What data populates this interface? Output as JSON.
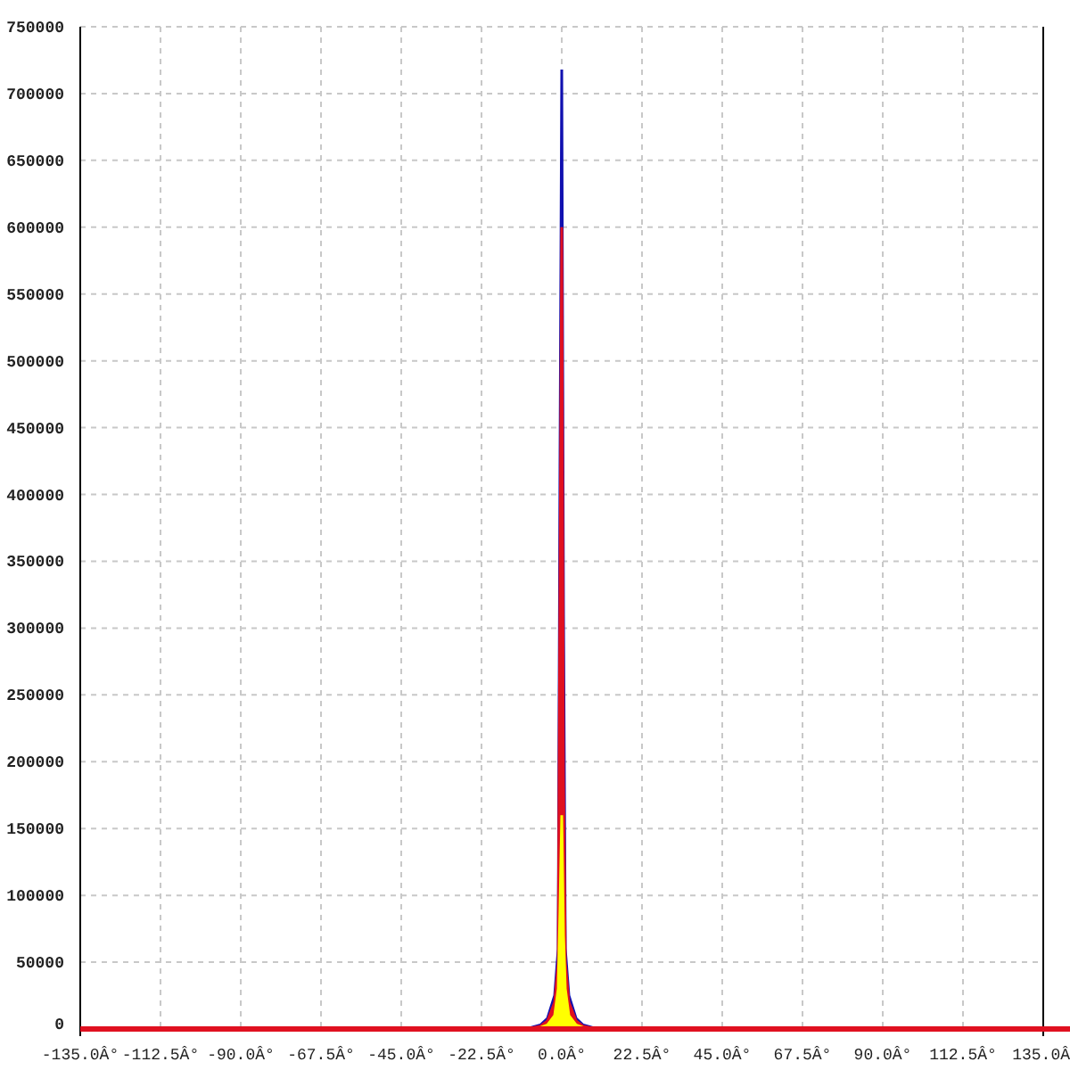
{
  "chart": {
    "chart_data": {
      "type": "area",
      "x": [
        -135,
        -10,
        -6,
        -4,
        -2,
        -1,
        -0.5,
        0,
        0.5,
        1,
        2,
        4,
        6,
        10,
        135
      ],
      "series": [
        {
          "color": "#1010b0",
          "values": [
            0,
            0,
            3000,
            8000,
            25000,
            60000,
            420000,
            718000,
            310000,
            60000,
            25000,
            8000,
            3000,
            0,
            0
          ]
        },
        {
          "color": "#e01020",
          "values": [
            0,
            0,
            2000,
            6000,
            20000,
            50000,
            330000,
            600000,
            190000,
            50000,
            20000,
            6000,
            2000,
            0,
            0
          ]
        },
        {
          "color": "#ffff00",
          "values": [
            0,
            0,
            1000,
            3000,
            10000,
            30000,
            90000,
            160000,
            70000,
            30000,
            10000,
            3000,
            1000,
            0,
            0
          ]
        }
      ],
      "xlim": [
        -135,
        135
      ],
      "ylim": [
        0,
        750000
      ],
      "xticks": [
        {
          "value": -135,
          "label": "-135.0Â°"
        },
        {
          "value": -112.5,
          "label": "-112.5Â°"
        },
        {
          "value": -90,
          "label": "-90.0Â°"
        },
        {
          "value": -67.5,
          "label": "-67.5Â°"
        },
        {
          "value": -45,
          "label": "-45.0Â°"
        },
        {
          "value": -22.5,
          "label": "-22.5Â°"
        },
        {
          "value": 0,
          "label": "0.0Â°"
        },
        {
          "value": 22.5,
          "label": "22.5Â°"
        },
        {
          "value": 45,
          "label": "45.0Â°"
        },
        {
          "value": 67.5,
          "label": "67.5Â°"
        },
        {
          "value": 90,
          "label": "90.0Â°"
        },
        {
          "value": 112.5,
          "label": "112.5Â°"
        },
        {
          "value": 135,
          "label": "135.0Â"
        }
      ],
      "grid": true,
      "yticks": [
        0,
        50000,
        100000,
        150000,
        200000,
        250000,
        300000,
        350000,
        400000,
        450000,
        500000,
        550000,
        600000,
        650000,
        700000,
        750000
      ]
    }
  }
}
